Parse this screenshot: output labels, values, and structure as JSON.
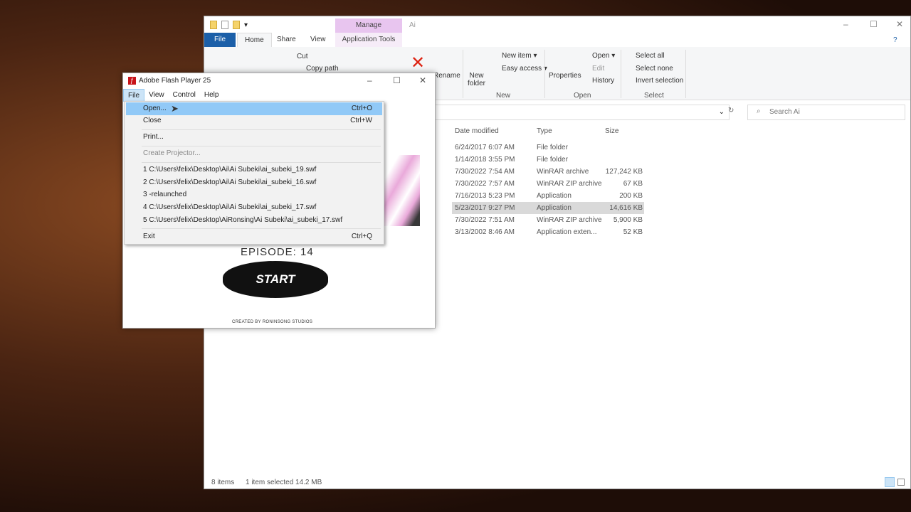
{
  "explorer": {
    "title": "Ai",
    "context_tab": "Manage",
    "context_sub": "Application Tools",
    "tabs": [
      "File",
      "Home",
      "Share",
      "View"
    ],
    "ribbon": {
      "cut": "Cut",
      "copy_path": "Copy path",
      "rename": "Rename",
      "new_folder": "New\nfolder",
      "new_item": "New item ▾",
      "easy_access": "Easy access ▾",
      "group_new": "New",
      "properties": "Properties",
      "open": "Open ▾",
      "edit": "Edit",
      "history": "History",
      "group_open": "Open",
      "select_all": "Select all",
      "select_none": "Select none",
      "invert_selection": "Invert selection",
      "group_select": "Select"
    },
    "search_placeholder": "Search Ai",
    "columns": [
      "Date modified",
      "Type",
      "Size"
    ],
    "rows": [
      {
        "date": "6/24/2017 6:07 AM",
        "type": "File folder",
        "size": ""
      },
      {
        "date": "1/14/2018 3:55 PM",
        "type": "File folder",
        "size": ""
      },
      {
        "date": "7/30/2022 7:54 AM",
        "type": "WinRAR archive",
        "size": "127,242 KB"
      },
      {
        "date": "7/30/2022 7:57 AM",
        "type": "WinRAR ZIP archive",
        "size": "67 KB"
      },
      {
        "date": "7/16/2013 5:23 PM",
        "type": "Application",
        "size": "200 KB"
      },
      {
        "date": "5/23/2017 9:27 PM",
        "type": "Application",
        "size": "14,616 KB",
        "selected": true
      },
      {
        "date": "7/30/2022 7:51 AM",
        "type": "WinRAR ZIP archive",
        "size": "5,900 KB"
      },
      {
        "date": "3/13/2002 8:46 AM",
        "type": "Application exten...",
        "size": "52 KB"
      }
    ],
    "status": {
      "items": "8 items",
      "selected": "1 item selected  14.2 MB"
    }
  },
  "flash": {
    "title": "Adobe Flash Player 25",
    "menubar": [
      "File",
      "View",
      "Control",
      "Help"
    ],
    "menu": {
      "open": "Open...",
      "open_sc": "Ctrl+O",
      "close": "Close",
      "close_sc": "Ctrl+W",
      "print": "Print...",
      "projector": "Create Projector...",
      "recent": [
        "1 C:\\Users\\felix\\Desktop\\Ai\\Ai Subeki\\ai_subeki_19.swf",
        "2 C:\\Users\\felix\\Desktop\\Ai\\Ai Subeki\\ai_subeki_16.swf",
        "3 -relaunched",
        "4 C:\\Users\\felix\\Desktop\\Ai\\Ai Subeki\\ai_subeki_17.swf",
        "5 C:\\Users\\felix\\Desktop\\AiRonsing\\Ai Subeki\\ai_subeki_17.swf"
      ],
      "exit": "Exit",
      "exit_sc": "Ctrl+Q"
    },
    "content": {
      "episode": "EPISODE: 14",
      "start": "START",
      "credit": "CREATED BY RONINSONG STUDIOS"
    }
  }
}
